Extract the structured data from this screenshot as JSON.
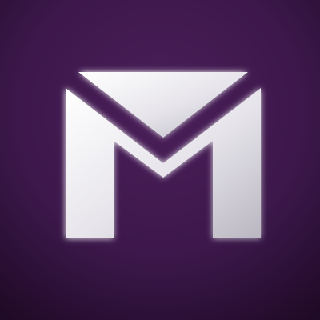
{
  "icon": {
    "name": "mail-envelope-m-logo",
    "colors": {
      "background_top": "#4a1f59",
      "background_center": "#3d184c",
      "background_bottom": "#1f0a26",
      "glyph_highlight": "#ffffff",
      "glyph_mid": "#e6e4ea",
      "glyph_shadow": "#b9b6c1"
    }
  }
}
